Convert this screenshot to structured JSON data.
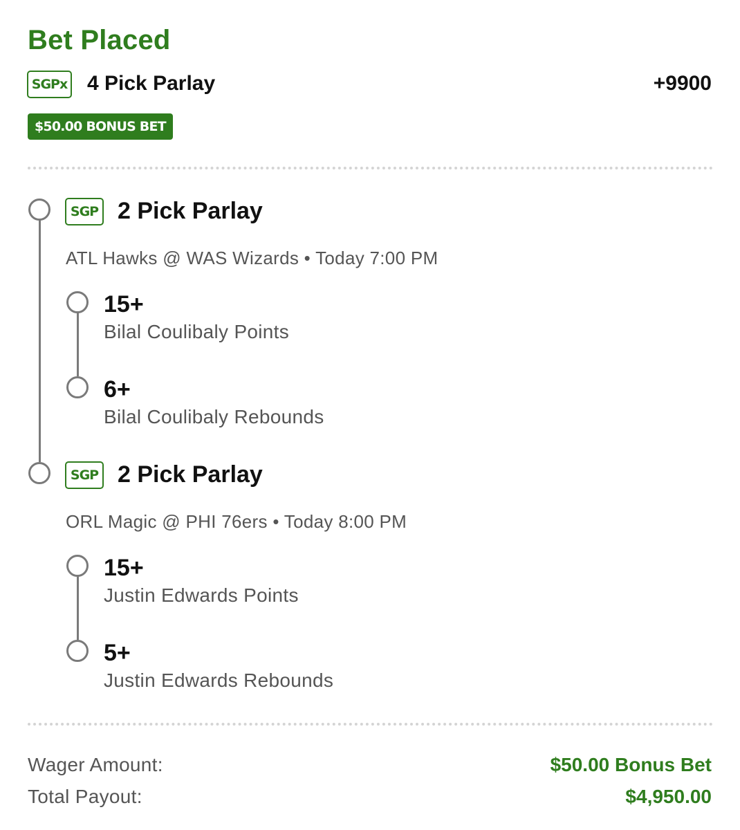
{
  "header": {
    "title": "Bet Placed",
    "tag": "SGPx",
    "parlay_title": "4 Pick Parlay",
    "odds": "+9900",
    "bonus_badge": "$50.00 BONUS BET"
  },
  "legs": [
    {
      "tag": "SGP",
      "title": "2 Pick Parlay",
      "game": "ATL Hawks @ WAS Wizards • Today 7:00 PM",
      "picks": [
        {
          "value": "15+",
          "desc": "Bilal Coulibaly Points"
        },
        {
          "value": "6+",
          "desc": "Bilal Coulibaly Rebounds"
        }
      ]
    },
    {
      "tag": "SGP",
      "title": "2 Pick Parlay",
      "game": "ORL Magic @ PHI 76ers • Today 8:00 PM",
      "picks": [
        {
          "value": "15+",
          "desc": "Justin Edwards Points"
        },
        {
          "value": "5+",
          "desc": "Justin Edwards Rebounds"
        }
      ]
    }
  ],
  "summary": {
    "wager_label": "Wager Amount:",
    "wager_value": "$50.00 Bonus Bet",
    "payout_label": "Total Payout:",
    "payout_value": "$4,950.00"
  },
  "colors": {
    "accent": "#2f7d1e",
    "timeline": "#7a7a7a"
  }
}
